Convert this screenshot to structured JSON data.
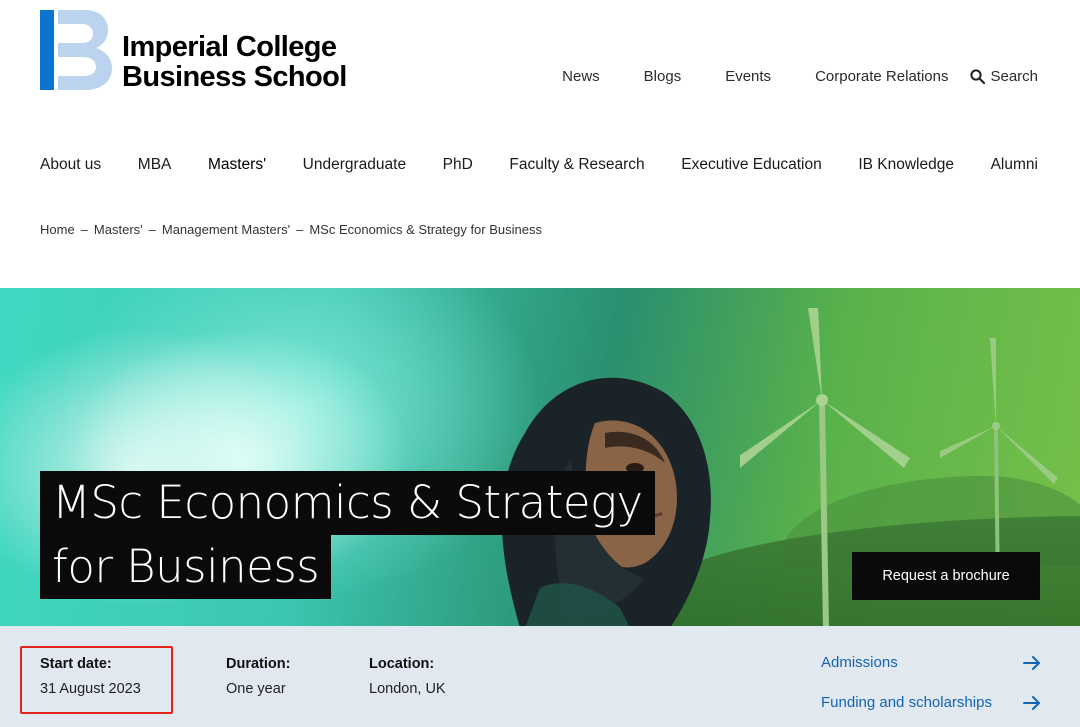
{
  "logo": {
    "line1": "Imperial College",
    "line2": "Business School",
    "accent_color": "#0b74d1"
  },
  "top_nav": {
    "items": [
      "News",
      "Blogs",
      "Events",
      "Corporate Relations"
    ],
    "search_label": "Search"
  },
  "main_nav": {
    "items": [
      "About us",
      "MBA",
      "Masters'",
      "Undergraduate",
      "PhD",
      "Faculty & Research",
      "Executive Education",
      "IB Knowledge",
      "Alumni"
    ],
    "active": "Masters'"
  },
  "breadcrumb": {
    "items": [
      "Home",
      "Masters'",
      "Management Masters'",
      "MSc Economics & Strategy for Business"
    ],
    "separator": "–"
  },
  "hero": {
    "title_line1": "MSc Economics & Strategy",
    "title_line2": "for Business",
    "cta_label": "Request a brochure"
  },
  "info": {
    "start_label": "Start date:",
    "start_value": "31 August 2023",
    "duration_label": "Duration:",
    "duration_value": "One year",
    "location_label": "Location:",
    "location_value": "London, UK",
    "links": [
      "Admissions",
      "Funding and scholarships"
    ],
    "link_color": "#1264b4",
    "highlight_color": "#e3231d"
  }
}
